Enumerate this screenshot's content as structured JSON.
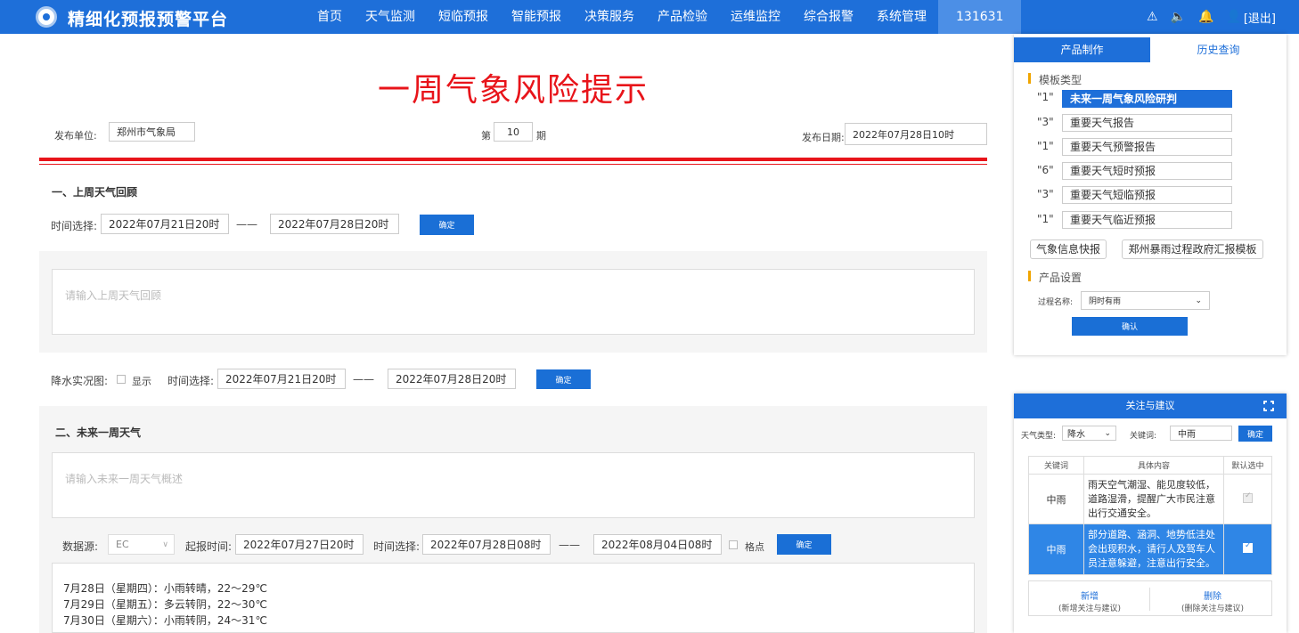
{
  "header": {
    "brand": "精细化预报预警平台",
    "nav": [
      "首页",
      "天气监测",
      "短临预报",
      "智能预报",
      "决策服务",
      "产品检验",
      "运维监控",
      "综合报警",
      "系统管理",
      "131631"
    ],
    "logout": "[退出]"
  },
  "doc": {
    "title": "一周气象风险提示",
    "publisher_label": "发布单位:",
    "publisher": "郑州市气象局",
    "issue_prefix": "第",
    "issue_no": "10",
    "issue_suffix": "期",
    "date_label": "发布日期:",
    "date": "2022年07月28日10时"
  },
  "section1": {
    "title": "一、上周天气回顾",
    "time_label": "时间选择:",
    "start": "2022年07月21日20时",
    "dash": "——",
    "end": "2022年07月28日20时",
    "confirm": "确定",
    "placeholder": "请输入上周天气回顾"
  },
  "rain": {
    "label": "降水实况图:",
    "show": "显示",
    "time_label": "时间选择:",
    "start": "2022年07月21日20时",
    "dash": "——",
    "end": "2022年07月28日20时",
    "confirm": "确定"
  },
  "section2": {
    "title": "二、未来一周天气",
    "placeholder": "请输入未来一周天气概述",
    "source_label": "数据源:",
    "source": "EC",
    "issue_label": "起报时间:",
    "issue_time": "2022年07月27日20时",
    "time_label": "时间选择:",
    "start": "2022年07月28日08时",
    "dash": "——",
    "end": "2022年08月04日08时",
    "grid": "格点",
    "confirm": "确定",
    "forecast": [
      "7月28日（星期四）：小雨转晴，22～29℃",
      "7月29日（星期五）：多云转阴，22～30℃",
      "7月30日（星期六）：小雨转阴，24～31℃"
    ]
  },
  "panel": {
    "tab_make": "产品制作",
    "tab_history": "历史查询",
    "template_title": "模板类型",
    "templates": [
      {
        "num": "\"1\"",
        "name": "未来一周气象风险研判"
      },
      {
        "num": "\"3\"",
        "name": "重要天气报告"
      },
      {
        "num": "\"1\"",
        "name": "重要天气预警报告"
      },
      {
        "num": "\"6\"",
        "name": "重要天气短时预报"
      },
      {
        "num": "\"3\"",
        "name": "重要天气短临预报"
      },
      {
        "num": "\"1\"",
        "name": "重要天气临近预报"
      }
    ],
    "btn_flash": "气象信息快报",
    "btn_report": "郑州暴雨过程政府汇报模板",
    "settings_title": "产品设置",
    "process_label": "过程名称:",
    "process_value": "阴时有雨",
    "confirm": "确认"
  },
  "advice": {
    "title": "关注与建议",
    "weather_type_label": "天气类型:",
    "weather_type": "降水",
    "keyword_label": "关键词:",
    "keyword": "中雨",
    "confirm": "确定",
    "columns": [
      "关键词",
      "具体内容",
      "默认选中"
    ],
    "rows": [
      {
        "keyword": "中雨",
        "content": "雨天空气潮湿、能见度较低，道路湿滑，提醒广大市民注意出行交通安全。"
      },
      {
        "keyword": "中雨",
        "content": "部分道路、涵洞、地势低洼处会出现积水，请行人及驾车人员注意躲避，注意出行安全。"
      }
    ],
    "add_label": "新增",
    "add_sub": "(新增关注与建议)",
    "del_label": "删除",
    "del_sub": "(删除关注与建议)"
  }
}
